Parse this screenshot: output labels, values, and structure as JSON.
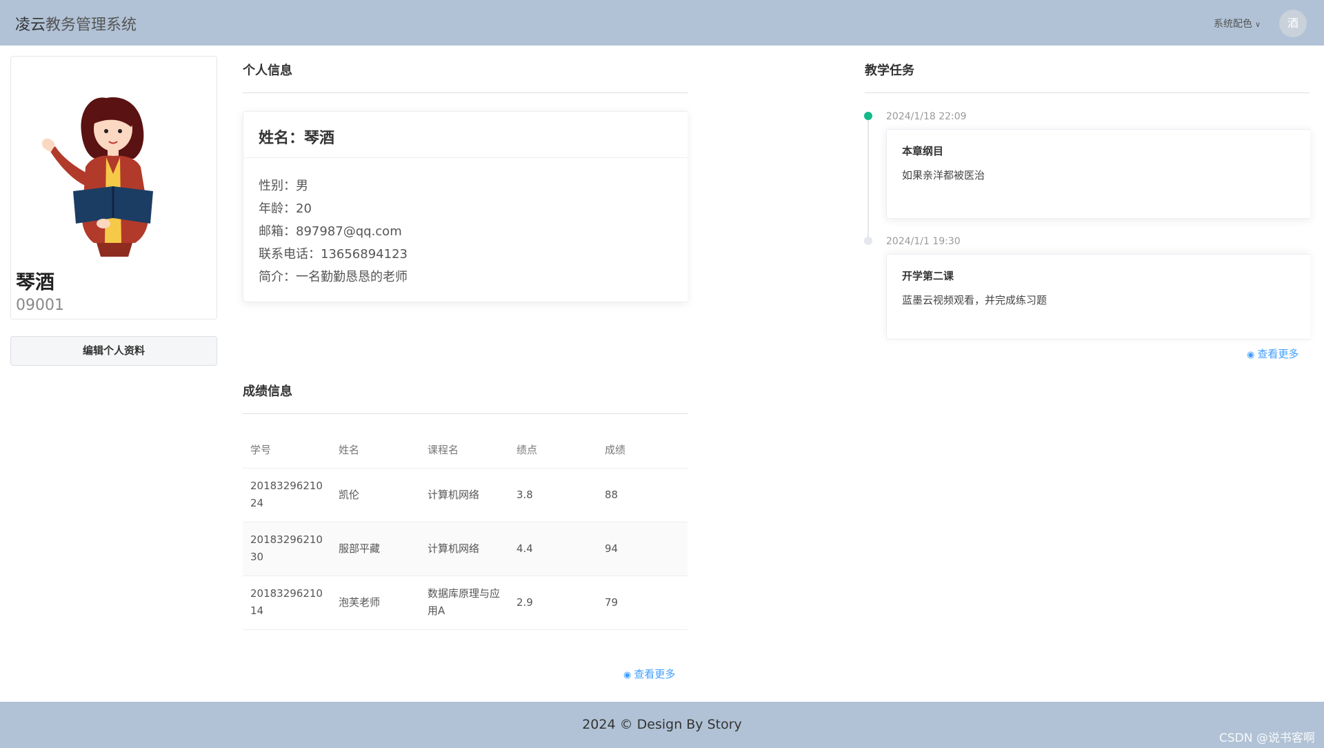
{
  "header": {
    "brand_main": "凌云",
    "brand_sub": "教务管理系统",
    "theme_label": "系统配色",
    "avatar_text": "酒"
  },
  "profile": {
    "name": "琴酒",
    "id": "09001",
    "edit_button": "编辑个人资料"
  },
  "personal_info": {
    "section_title": "个人信息",
    "card_title": "姓名：琴酒",
    "lines": [
      "性别：男",
      "年龄：20",
      "邮箱：897987@qq.com",
      "联系电话：13656894123",
      "简介：一名勤勤恳恳的老师"
    ]
  },
  "grades": {
    "section_title": "成绩信息",
    "columns": [
      "学号",
      "姓名",
      "课程名",
      "绩点",
      "成绩"
    ],
    "rows": [
      [
        "2018329621024",
        "凯伦",
        "计算机网络",
        "3.8",
        "88"
      ],
      [
        "2018329621030",
        "服部平藏",
        "计算机网络",
        "4.4",
        "94"
      ],
      [
        "2018329621014",
        "泡芙老师",
        "数据库原理与应用A",
        "2.9",
        "79"
      ]
    ],
    "more_link": "查看更多"
  },
  "tasks": {
    "section_title": "教学任务",
    "items": [
      {
        "time": "2024/1/18 22:09",
        "title": "本章纲目",
        "desc": "如果亲洋都被医治",
        "dot_color": "#13b98a"
      },
      {
        "time": "2024/1/1 19:30",
        "title": "开学第二课",
        "desc": "蓝墨云视频观看，并完成练习题",
        "dot_color": "#e4e7ed"
      }
    ],
    "more_link": "查看更多"
  },
  "footer": {
    "text": "2024 © Design By Story",
    "watermark": "CSDN @说书客啊"
  }
}
